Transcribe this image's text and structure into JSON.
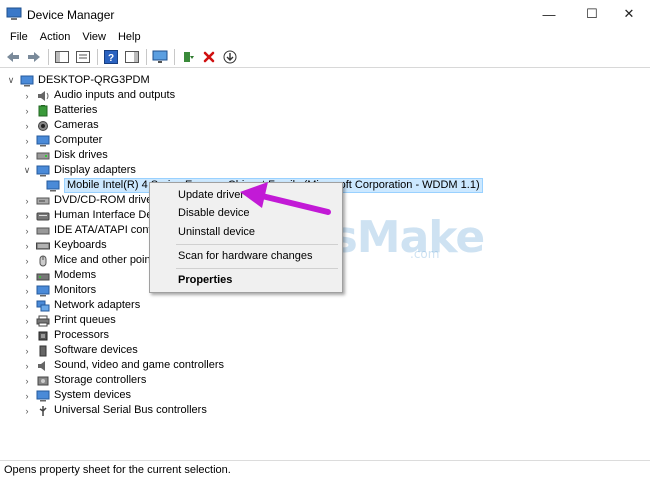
{
  "window": {
    "title": "Device Manager",
    "minimize_glyph": "—",
    "maximize_glyph": "☐",
    "close_glyph": "✕"
  },
  "menu": [
    "File",
    "Action",
    "View",
    "Help"
  ],
  "toolbar": {
    "icons": [
      "back-icon",
      "forward-icon",
      "show-hide-console-tree-icon",
      "properties-icon",
      "help-icon",
      "action-pane-icon",
      "scan-monitor-icon",
      "update-driver-icon",
      "uninstall-icon",
      "download-icon"
    ]
  },
  "tree": {
    "root": "DESKTOP-QRG3PDM",
    "categories": [
      "Audio inputs and outputs",
      "Batteries",
      "Cameras",
      "Computer",
      "Disk drives",
      "Display adapters",
      "Mobile Intel(R) 4 Series Express Chipset Family (Microsoft Corporation - WDDM 1.1)",
      "DVD/CD-ROM drives",
      "Human Interface Devices",
      "IDE ATA/ATAPI controllers",
      "Keyboards",
      "Mice and other pointing devices",
      "Modems",
      "Monitors",
      "Network adapters",
      "Print queues",
      "Processors",
      "Software devices",
      "Sound, video and game controllers",
      "Storage controllers",
      "System devices",
      "Universal Serial Bus controllers"
    ]
  },
  "context_menu": {
    "items": [
      "Update driver",
      "Disable device",
      "Uninstall device",
      "Scan for hardware changes",
      "Properties"
    ]
  },
  "watermark": {
    "text": "TipsMake",
    "suffix": ".com"
  },
  "status": "Opens property sheet for the current selection.",
  "colors": {
    "selection_bg": "#cce8ff",
    "arrow": "#c21ad6",
    "menu_bg": "#f0f0f0"
  }
}
